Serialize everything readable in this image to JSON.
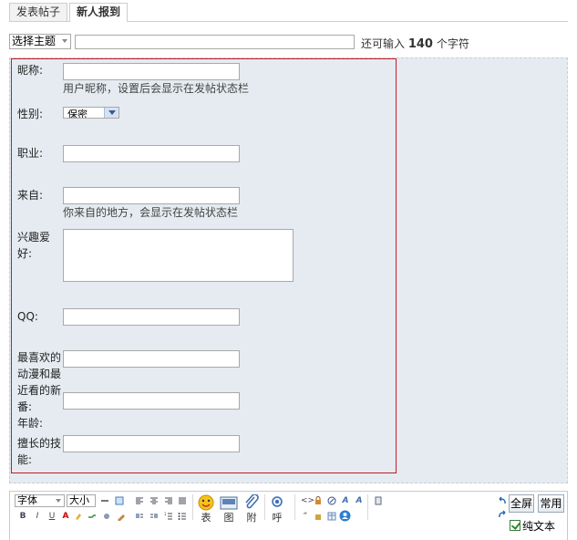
{
  "tabs": [
    {
      "label": "发表帖子",
      "active": false
    },
    {
      "label": "新人报到",
      "active": true
    }
  ],
  "subject": {
    "topic_select": "选择主题",
    "title_value": "",
    "remain_prefix": "还可输入",
    "remain_count": "140",
    "remain_suffix": "个字符"
  },
  "form": {
    "nickname_label": "昵称:",
    "nickname_hint": "用户昵称，设置后会显示在发帖状态栏",
    "gender_label": "性别:",
    "gender_value": "保密",
    "job_label": "职业:",
    "from_label": "来自:",
    "from_hint": "你来自的地方，会显示在发帖状态栏",
    "hobby_label_1": "兴趣爱",
    "hobby_label_2": "好:",
    "qq_label": "QQ:",
    "anime_label_1": "最喜欢的",
    "anime_label_2": "动漫和最",
    "anime_label_3": "近看的新",
    "anime_label_4": "番:",
    "age_label": "年龄:",
    "skill_label_1": "擅长的技",
    "skill_label_2": "能:"
  },
  "toolbar": {
    "font_select": "字体",
    "size_select": "大小",
    "emoji_label": "表",
    "image_label": "图",
    "attach_label": "附",
    "at_label": "呼",
    "fullscreen_label": "全屏",
    "common_label": "常用",
    "plaintext_label": "纯文本"
  },
  "colors": {
    "template_border": "#c41c2a",
    "editor_bg": "#e5ebf0"
  }
}
